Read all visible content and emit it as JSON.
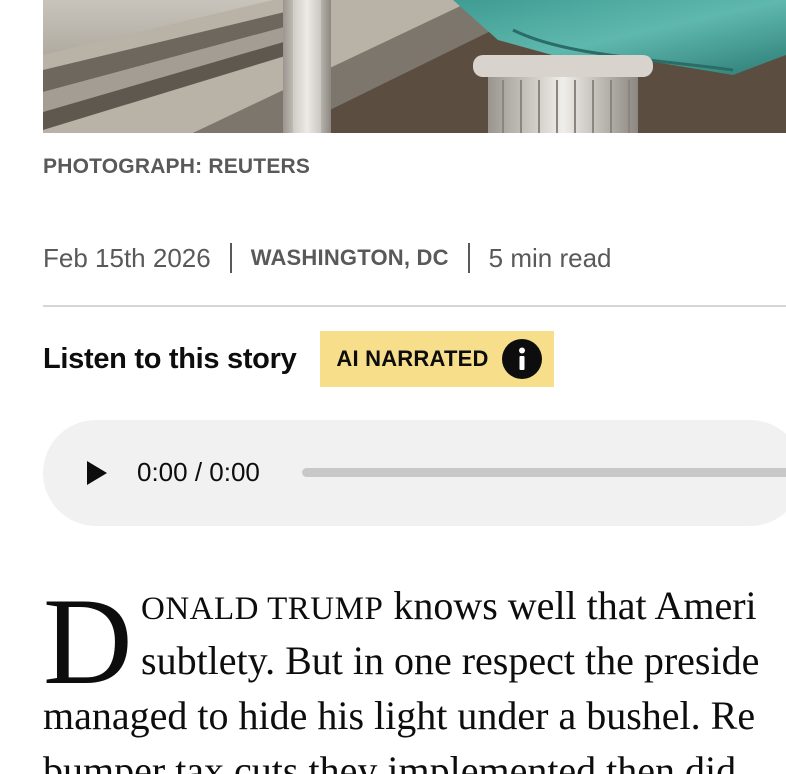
{
  "photo": {
    "alt_icon": "building-columns-flag-photo"
  },
  "credit": "PHOTOGRAPH: REUTERS",
  "meta": {
    "date": "Feb 15th 2026",
    "location": "WASHINGTON, DC",
    "read_time": "5 min read"
  },
  "listen": {
    "title": "Listen to this story",
    "badge": "AI NARRATED",
    "badge_color": "#f6de8b"
  },
  "player": {
    "time": "0:00 / 0:00",
    "progress": 0,
    "background": "#f1f1f1"
  },
  "article": {
    "dropcap": "D",
    "lead_smallcaps": "ONALD TRUMP",
    "line1_rest": " knows well that Ameri",
    "line2": "subtlety. But in one respect the preside",
    "line3": "managed to hide his light under a bushel. Re",
    "line4": "bumper tax cuts they implemented then did"
  }
}
